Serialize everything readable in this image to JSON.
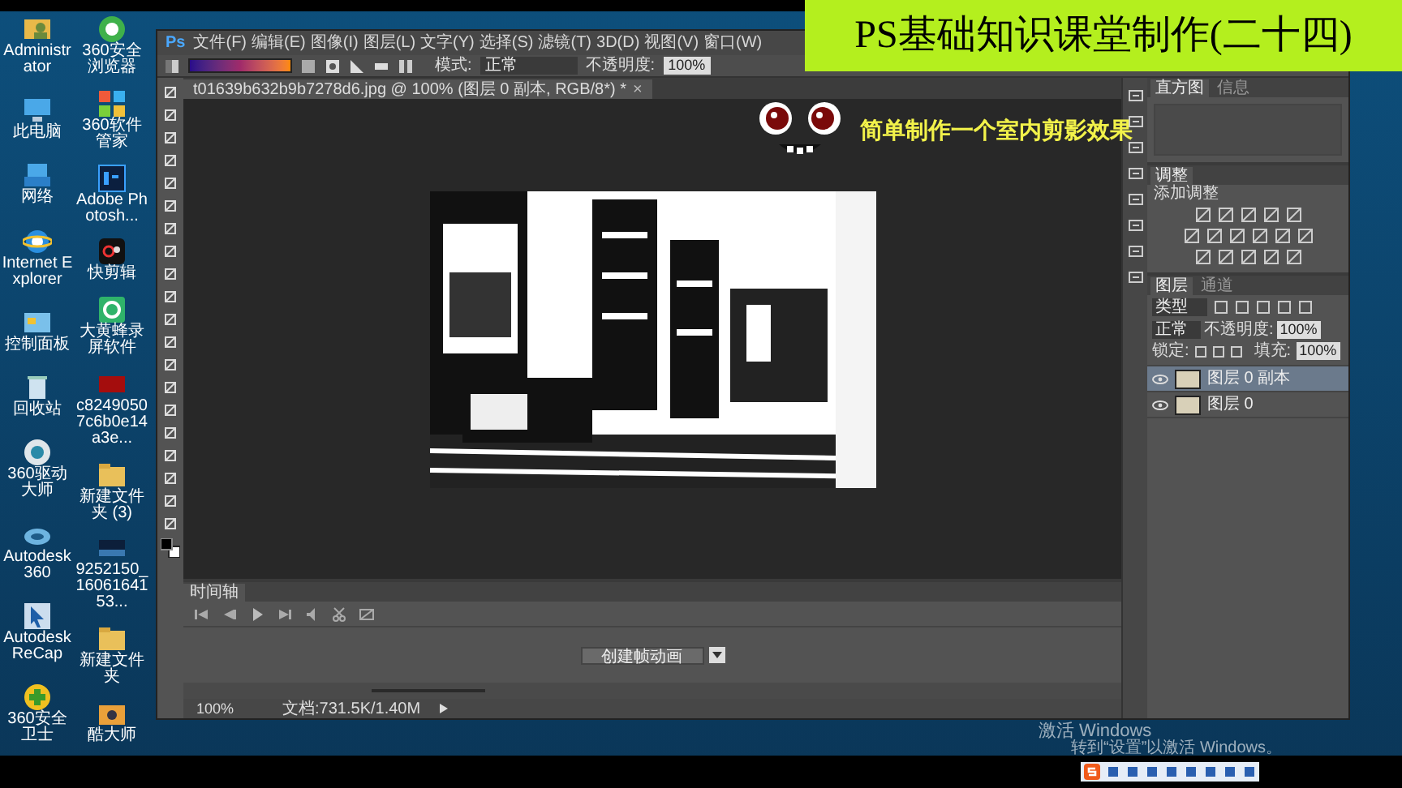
{
  "desktop": {
    "columns": [
      {
        "icons": [
          {
            "label": "Administrator",
            "kind": "user",
            "selected": false
          },
          {
            "label": "此电脑",
            "kind": "computer",
            "selected": false
          },
          {
            "label": "网络",
            "kind": "network",
            "selected": false
          },
          {
            "label": "Internet Explorer",
            "kind": "ie",
            "selected": false
          },
          {
            "label": "控制面板",
            "kind": "control",
            "selected": false
          },
          {
            "label": "回收站",
            "kind": "bin",
            "selected": false
          },
          {
            "label": "360驱动大师",
            "kind": "drive",
            "selected": false
          },
          {
            "label": "Autodesk 360",
            "kind": "cloud",
            "selected": false
          },
          {
            "label": "Autodesk ReCap",
            "kind": "recap",
            "selected": false
          },
          {
            "label": "360安全卫士",
            "kind": "shield",
            "selected": false
          }
        ]
      },
      {
        "icons": [
          {
            "label": "360安全浏览器",
            "kind": "browser",
            "selected": false
          },
          {
            "label": "360软件管家",
            "kind": "apps",
            "selected": false
          },
          {
            "label": "Adobe Photosh...",
            "kind": "ps",
            "selected": false
          },
          {
            "label": "快剪辑",
            "kind": "clip",
            "selected": false
          },
          {
            "label": "大黄蜂录屏软件",
            "kind": "recorder",
            "selected": false
          },
          {
            "label": "c82490507c6b0e14a3e...",
            "kind": "video",
            "selected": false
          },
          {
            "label": "新建文件夹 (3)",
            "kind": "folder",
            "selected": false
          },
          {
            "label": "9252150_1606164153...",
            "kind": "image",
            "selected": false
          },
          {
            "label": "新建文件夹",
            "kind": "folder",
            "selected": false
          },
          {
            "label": "酷大师",
            "kind": "tool",
            "selected": false
          }
        ]
      }
    ]
  },
  "photoshop": {
    "logo": "Ps",
    "menu": [
      "文件(F)",
      "编辑(E)",
      "图像(I)",
      "图层(L)",
      "文字(Y)",
      "选择(S)",
      "滤镜(T)",
      "3D(D)",
      "视图(V)",
      "窗口(W)"
    ],
    "options": {
      "mode_label": "模式:",
      "mode": "正常",
      "opacity_label": "不透明度:",
      "opacity": "100%"
    },
    "document_tab": {
      "title": "t01639b632b9b7278d6.jpg @ 100% (图层 0 副本, RGB/8*) *",
      "close": "×"
    },
    "timeline": {
      "tab": "时间轴",
      "create_button": "创建帧动画"
    },
    "status": {
      "zoom": "100%",
      "doc": "文档:731.5K/1.40M"
    },
    "panels": {
      "histogram_tabs": [
        {
          "label": "直方图",
          "selected": true
        },
        {
          "label": "信息",
          "selected": false
        }
      ],
      "adjustments": {
        "tab": "调整",
        "label": "添加调整"
      },
      "layers_tabs": [
        {
          "label": "图层",
          "selected": true
        },
        {
          "label": "通道",
          "selected": false
        }
      ],
      "filter": "类型",
      "blend": "正常",
      "opacity_label": "不透明度:",
      "opacity": "100%",
      "lock_label": "锁定:",
      "fill_label": "填充:",
      "fill": "100%",
      "layers": [
        {
          "name": "图层 0 副本",
          "selected": true,
          "visible": true
        },
        {
          "name": "图层 0",
          "selected": false,
          "visible": true
        }
      ]
    }
  },
  "banner": {
    "title": "PS基础知识课堂制作(二十四)"
  },
  "caption": "简单制作一个室内剪影效果",
  "activation": {
    "title": "激活 Windows",
    "subtitle": "转到“设置”以激活 Windows。"
  }
}
